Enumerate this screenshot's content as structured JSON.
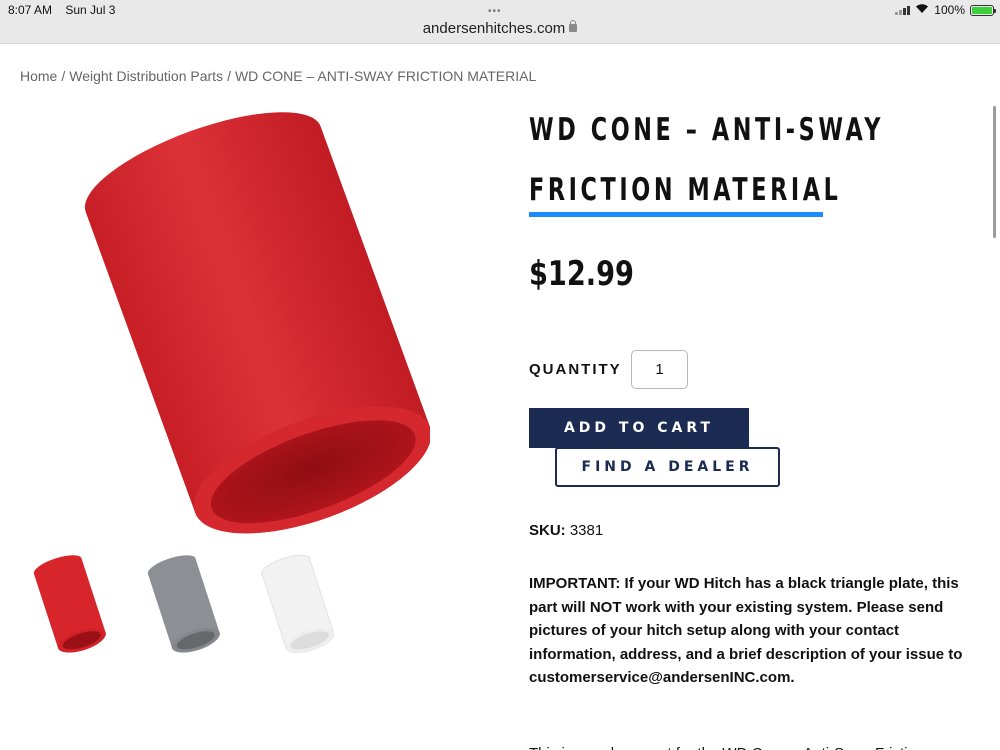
{
  "status_bar": {
    "time": "8:07 AM",
    "date": "Sun Jul 3",
    "battery_percent": "100%",
    "menu_dots": "•••"
  },
  "browser": {
    "url": "andersenhitches.com"
  },
  "breadcrumb": {
    "home": "Home",
    "separator": "/",
    "category": "Weight Distribution Parts",
    "current": "WD CONE – ANTI-SWAY FRICTION MATERIAL"
  },
  "product": {
    "title_line1": "WD CONE – ANTI-SWAY",
    "title_line2": "FRICTION MATERIAL",
    "price": "$12.99",
    "quantity_label": "QUANTITY",
    "quantity_value": "1",
    "add_to_cart_label": "ADD TO CART",
    "find_dealer_label": "FIND A DEALER",
    "sku_label": "SKU:",
    "sku_value": "3381",
    "important_text": "IMPORTANT: If your WD Hitch has a black triangle plate, this part will NOT work with your existing system. Please send pictures of your hitch setup along with your contact information, address, and a brief description of your issue to customerservice@andersenINC.com.",
    "description_partial": "This is a replacement for the WD Cone – Anti-Sway Friction"
  },
  "thumbnails": [
    {
      "name": "red",
      "color": "#d8242b"
    },
    {
      "name": "gray",
      "color": "#8d8f94"
    },
    {
      "name": "white",
      "color": "#f2f2f2"
    }
  ],
  "colors": {
    "accent_blue": "#1a8cff",
    "navy": "#1c2b52",
    "product_red": "#d8242b"
  }
}
